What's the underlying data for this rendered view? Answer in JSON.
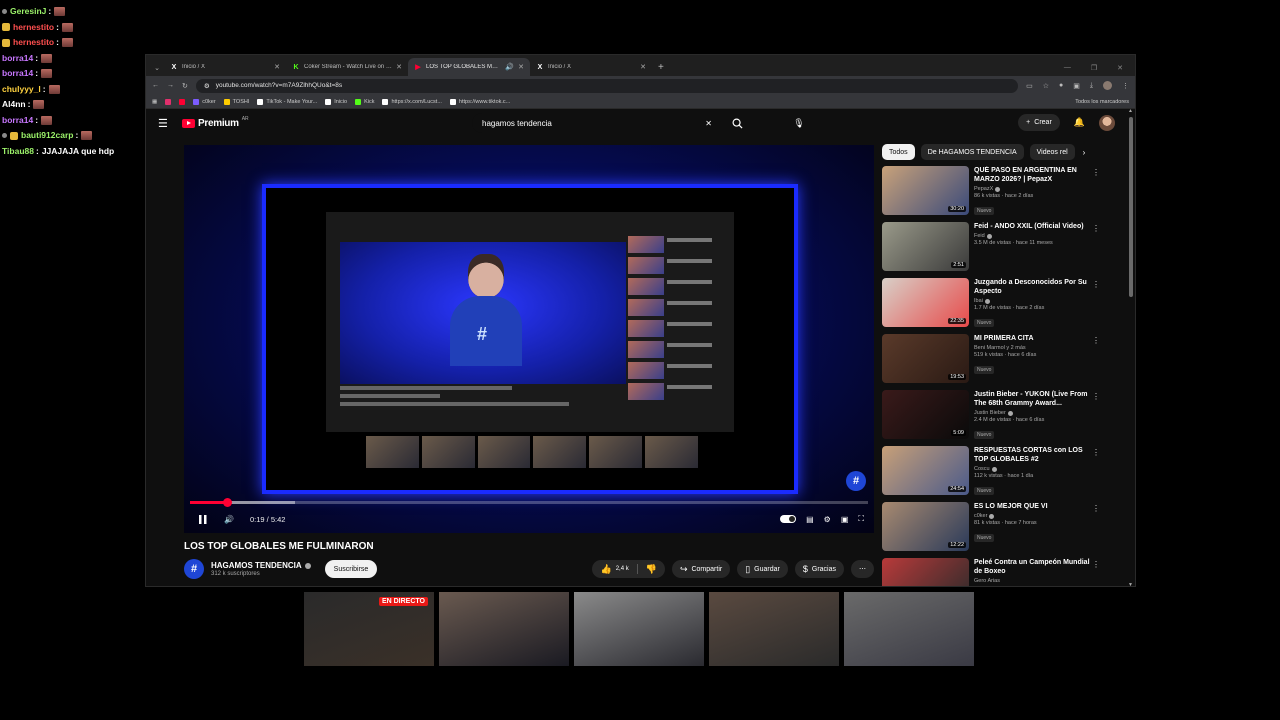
{
  "chat": [
    {
      "user": "GeresinJ",
      "color": "#9cf26a",
      "badge": "dot",
      "message": ""
    },
    {
      "user": "hernestito",
      "color": "#ff4f4f",
      "badge": "gold",
      "message": ""
    },
    {
      "user": "hernestito",
      "color": "#ff4f4f",
      "badge": "gold",
      "message": ""
    },
    {
      "user": "borra14",
      "color": "#c877ff",
      "badge": "none",
      "message": ""
    },
    {
      "user": "borra14",
      "color": "#c877ff",
      "badge": "none",
      "message": ""
    },
    {
      "user": "chulyyy_l",
      "color": "#ffd23f",
      "badge": "none",
      "message": ""
    },
    {
      "user": "Al4nn",
      "color": "#ffffff",
      "badge": "none",
      "message": ""
    },
    {
      "user": "borra14",
      "color": "#c877ff",
      "badge": "none",
      "message": ""
    },
    {
      "user": "bauti912carp",
      "color": "#9cf26a",
      "badge": "both",
      "message": ""
    },
    {
      "user": "Tibau88",
      "color": "#9cf26a",
      "badge": "none",
      "message": "JJAJAJA que hdp"
    }
  ],
  "browser": {
    "tabs": [
      {
        "label": "Inicio / X",
        "icon": "x-logo-icon",
        "active": false
      },
      {
        "label": "Coker Stream - Watch Live on Kick",
        "icon": "kick-logo-icon",
        "active": false
      },
      {
        "label": "LOS TOP GLOBALES ME FULMINARON",
        "icon": "youtube-logo-icon",
        "active": true
      },
      {
        "label": "Inicio / X",
        "icon": "x-logo-icon",
        "active": false
      }
    ],
    "url": "youtube.com/watch?v=m7A9ZlhhQUo&t=8s",
    "bookmarks": [
      {
        "label": "",
        "color": "#e1306c"
      },
      {
        "label": "",
        "color": "#ff0033"
      },
      {
        "label": "c0ker",
        "color": "#7c5cff"
      },
      {
        "label": "TOSHI",
        "color": "#ffcc00"
      },
      {
        "label": "TikTok - Make Your...",
        "color": "#ffffff"
      },
      {
        "label": "Inicio",
        "color": "#ffffff"
      },
      {
        "label": "Kick",
        "color": "#53fc18"
      },
      {
        "label": "https://x.com/Lucst...",
        "color": "#ffffff"
      },
      {
        "label": "https://www.tiktok.c...",
        "color": "#ffffff"
      }
    ],
    "bookmarks_right": "Todos los marcadores"
  },
  "youtube": {
    "logo": "Premium",
    "logo_region": "AR",
    "search_value": "hagamos tendencia",
    "create_label": "Crear",
    "player": {
      "current_time": "0:19",
      "duration": "5:42",
      "time_text": "0:19 / 5:42",
      "progress_fraction": 0.055,
      "buffer_fraction": 0.155
    },
    "video_title": "LOS TOP GLOBALES ME FULMINARON",
    "channel": {
      "name": "HAGAMOS TENDENCIA",
      "subs": "312 k suscriptores",
      "subscribe_label": "Suscribirse"
    },
    "likes": "2,4 k",
    "actions": {
      "share": "Compartir",
      "save": "Guardar",
      "thanks": "Gracias"
    },
    "chips": [
      "Todos",
      "De HAGAMOS TENDENCIA",
      "Videos rel"
    ],
    "recommendations": [
      {
        "title": "QUÉ PASÓ EN ARGENTINA EN MARZO 2026? | PepazX",
        "channel": "PepazX",
        "verified": true,
        "meta": "86 k vistas · hace 2 días",
        "badge": "Nuevo",
        "duration": "30:20",
        "thumb": [
          "#c9a27a",
          "#3a4a7a"
        ]
      },
      {
        "title": "Feid - ANDO XXIL (Official Video)",
        "channel": "Feid",
        "verified": true,
        "meta": "3.5 M de vistas · hace 11 meses",
        "badge": "",
        "duration": "2:51",
        "thumb": [
          "#9a9a8a",
          "#3a3a3a"
        ]
      },
      {
        "title": "Juzgando a Desconocidos Por Su Aspecto",
        "channel": "Ibai",
        "verified": true,
        "meta": "1.7 M de vistas · hace 2 días",
        "badge": "Nuevo",
        "duration": "22:35",
        "thumb": [
          "#d8d0c8",
          "#e74a4a"
        ]
      },
      {
        "title": "MI PRIMERA CITA",
        "channel": "Beni Marmol y 2 más",
        "verified": false,
        "meta": "519 k vistas · hace 6 días",
        "badge": "Nuevo",
        "duration": "19:53",
        "thumb": [
          "#5a3a2a",
          "#2a1a14"
        ]
      },
      {
        "title": "Justin Bieber - YUKON (Live From The 68th Grammy Award...",
        "channel": "Justin Bieber",
        "verified": true,
        "meta": "2.4 M de vistas · hace 6 días",
        "badge": "Nuevo",
        "duration": "5:09",
        "thumb": [
          "#3a1a1a",
          "#0a0a0a"
        ]
      },
      {
        "title": "RESPUESTAS CORTAS con LOS TOP GLOBALES #2",
        "channel": "Coscu",
        "verified": true,
        "meta": "112 k vistas · hace 1 día",
        "badge": "Nuevo",
        "duration": "24:54",
        "thumb": [
          "#c8a078",
          "#4a5a8a"
        ]
      },
      {
        "title": "ES LO MEJOR QUE VI",
        "channel": "c0ker",
        "verified": true,
        "meta": "81 k vistas · hace 7 horas",
        "badge": "Nuevo",
        "duration": "12:22",
        "thumb": [
          "#a88a70",
          "#2a3a5a"
        ]
      },
      {
        "title": "Peleé Contra un Campeón Mundial de Boxeo",
        "channel": "Gero Arias",
        "verified": false,
        "meta": "",
        "badge": "",
        "duration": "",
        "thumb": [
          "#b83a3a",
          "#2a2a2a"
        ]
      }
    ]
  },
  "cams": [
    {
      "live_label": "EN DIRECTO",
      "colors": [
        "#2a2a2a",
        "#3a3028"
      ]
    },
    {
      "live_label": "",
      "colors": [
        "#6a5a50",
        "#1a1a22"
      ]
    },
    {
      "live_label": "",
      "colors": [
        "#8a8a8a",
        "#2a2a30"
      ]
    },
    {
      "live_label": "",
      "colors": [
        "#5a4a40",
        "#2a2a2a"
      ]
    },
    {
      "live_label": "",
      "colors": [
        "#6a6a6a",
        "#3a3a44"
      ]
    }
  ]
}
